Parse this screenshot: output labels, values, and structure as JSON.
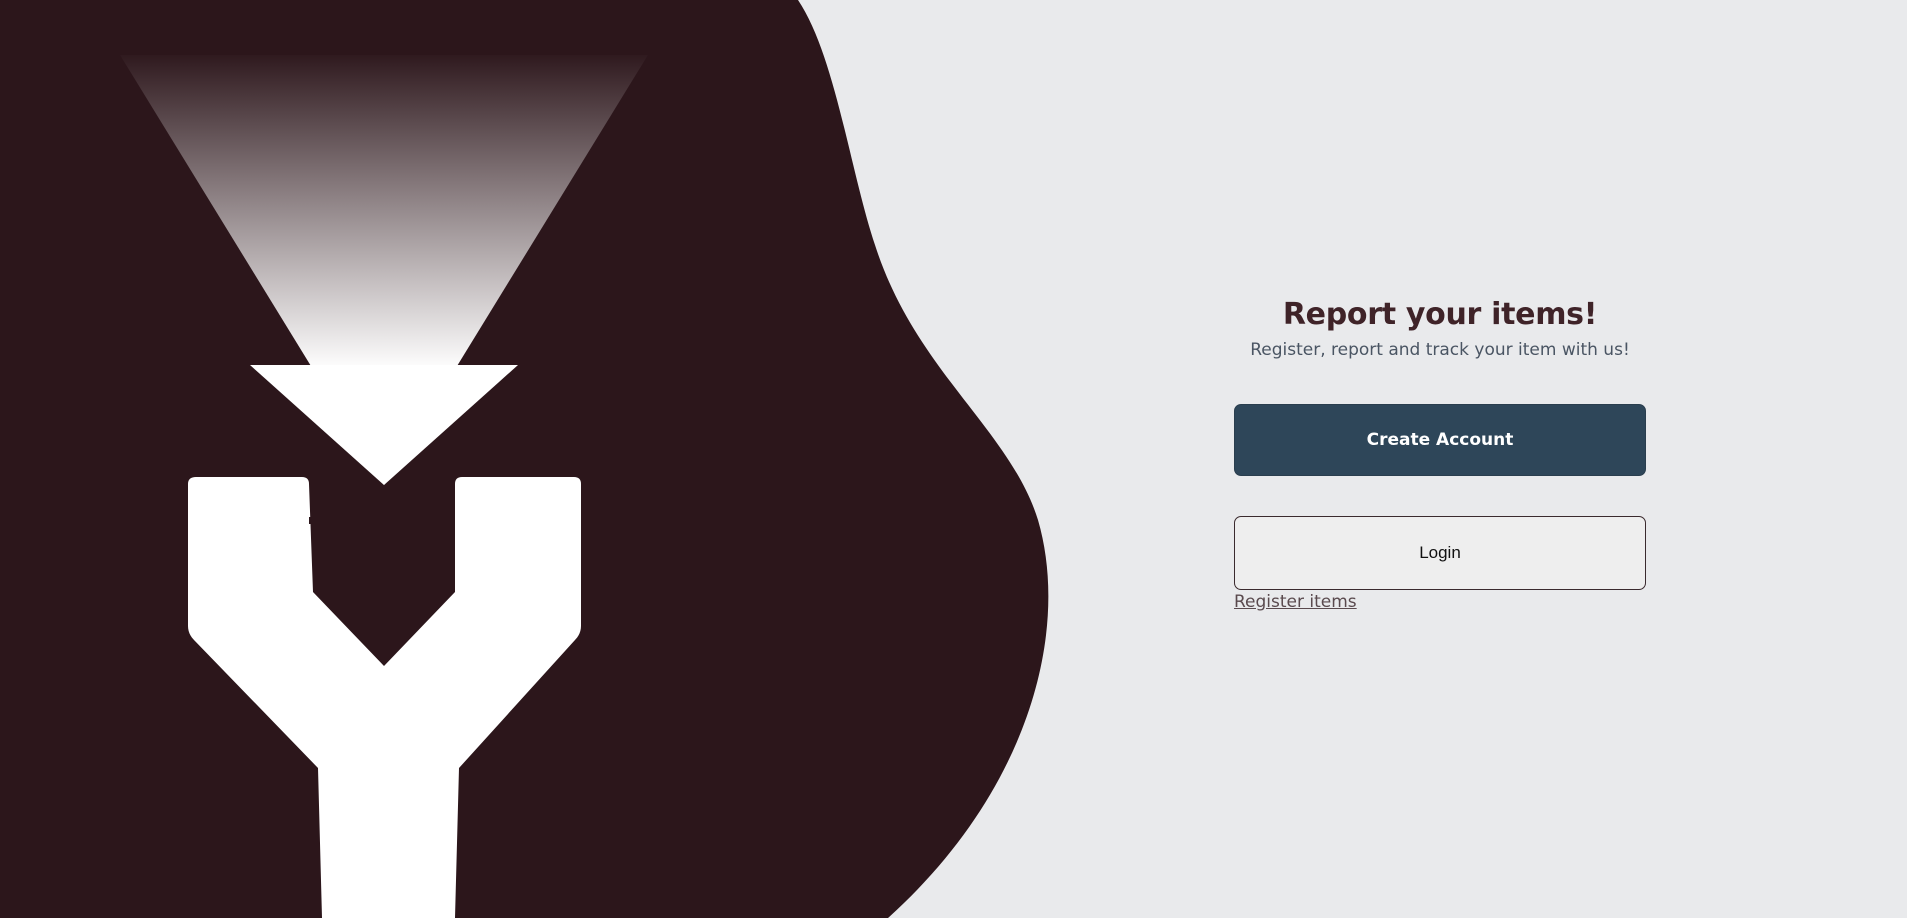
{
  "hero": {
    "logo_icon": "y-flashlight-logo-icon",
    "background_color": "#2c161b",
    "logo_color": "#ffffff"
  },
  "panel": {
    "title": "Report your items!",
    "subtitle": "Register, report and track your item with us!",
    "create_account_label": "Create Account",
    "login_label": "Login",
    "register_items_label": "Register items"
  },
  "colors": {
    "page_background": "#e9eaec",
    "primary_button": "#2e4659",
    "title_text": "#3f2328"
  }
}
